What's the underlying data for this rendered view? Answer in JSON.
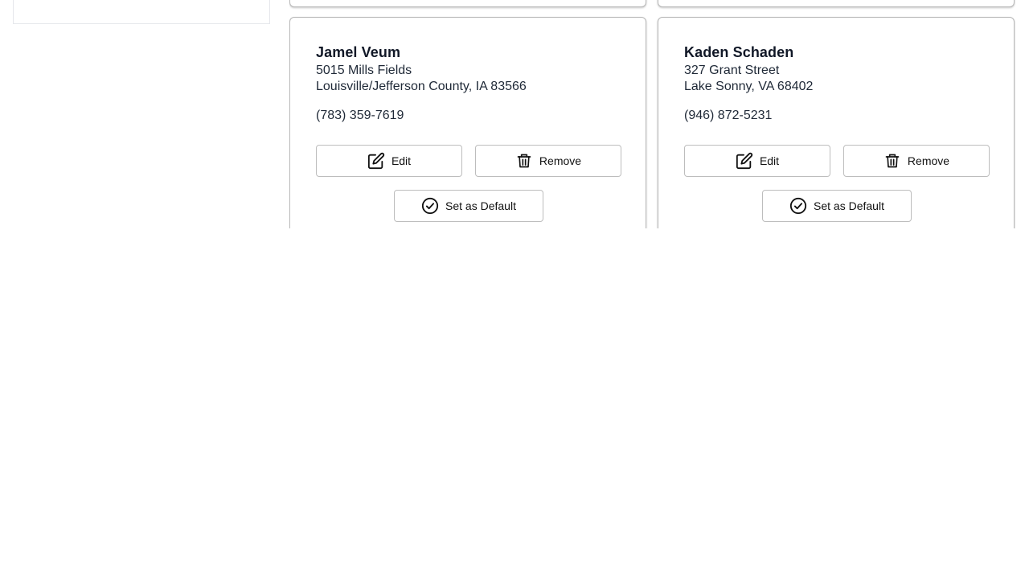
{
  "addresses": [
    {
      "name": "Jamel Veum",
      "line1": "5015 Mills Fields",
      "line2": "Louisville/Jefferson County, IA 83566",
      "phone": "(783) 359-7619",
      "actions": {
        "edit": "Edit",
        "remove": "Remove",
        "set_default": "Set as Default"
      }
    },
    {
      "name": "Kaden Schaden",
      "line1": "327 Grant Street",
      "line2": "Lake Sonny, VA 68402",
      "phone": "(946) 872-5231",
      "actions": {
        "edit": "Edit",
        "remove": "Remove",
        "set_default": "Set as Default"
      }
    }
  ],
  "icons": {
    "edit": "edit-icon",
    "remove": "trash-icon",
    "set_default": "check-circle-icon"
  }
}
